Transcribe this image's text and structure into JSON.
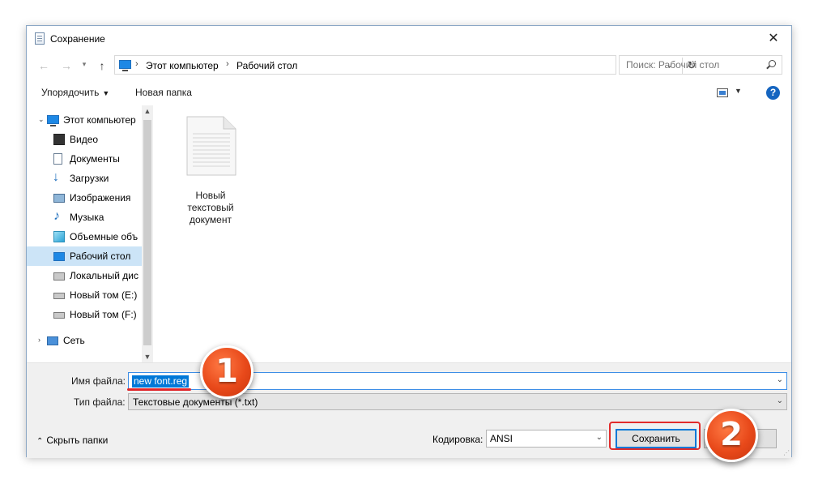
{
  "window": {
    "title": "Сохранение"
  },
  "address": {
    "crumbs": [
      "Этот компьютер",
      "Рабочий стол"
    ],
    "search_placeholder": "Поиск: Рабочий стол"
  },
  "toolbar": {
    "organize": "Упорядочить",
    "new_folder": "Новая папка",
    "help": "?"
  },
  "nav": {
    "items": [
      {
        "label": "Этот компьютер",
        "icon": "computer-icon"
      },
      {
        "label": "Видео",
        "icon": "video-icon"
      },
      {
        "label": "Документы",
        "icon": "documents-icon"
      },
      {
        "label": "Загрузки",
        "icon": "downloads-icon"
      },
      {
        "label": "Изображения",
        "icon": "pictures-icon"
      },
      {
        "label": "Музыка",
        "icon": "music-icon"
      },
      {
        "label": "Объемные объ",
        "icon": "3d-objects-icon"
      },
      {
        "label": "Рабочий стол",
        "icon": "desktop-icon"
      },
      {
        "label": "Локальный дис",
        "icon": "drive-icon"
      },
      {
        "label": "Новый том (E:)",
        "icon": "drive-icon"
      },
      {
        "label": "Новый том (F:)",
        "icon": "drive-icon"
      },
      {
        "label": "Сеть",
        "icon": "network-icon"
      }
    ],
    "selected": "Рабочий стол"
  },
  "files": [
    {
      "line1": "Новый",
      "line2": "текстовый",
      "line3": "документ",
      "icon": "text-file-icon"
    }
  ],
  "form": {
    "filename_label": "Имя файла:",
    "filename_value": "new font.reg",
    "filetype_label": "Тип файла:",
    "filetype_value": "Текстовые документы (*.txt)",
    "hide_folders": "Скрыть папки",
    "encoding_label": "Кодировка:",
    "encoding_value": "ANSI",
    "save_button": "Сохранить",
    "cancel_button": ""
  },
  "annotations": {
    "step1": "1",
    "step2": "2",
    "color": "#e8491a"
  },
  "colors": {
    "accent": "#0078d7",
    "selection": "#cce4f7",
    "annotation_red": "#e22b2b"
  }
}
